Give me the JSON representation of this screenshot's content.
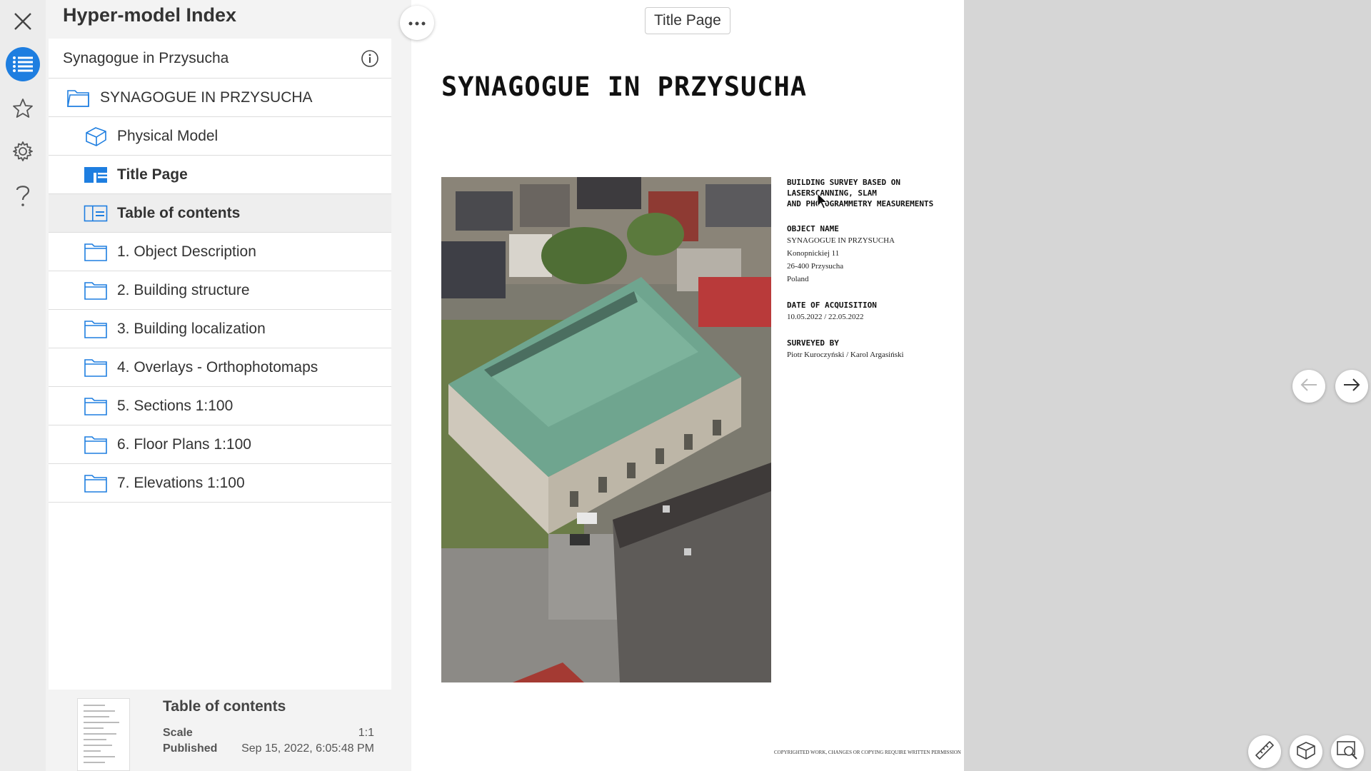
{
  "colors": {
    "accent": "#1e7ee0",
    "icon_blue": "#1e7ee0"
  },
  "rail": {
    "icons": [
      "close-icon",
      "index-list-icon",
      "star-icon",
      "gear-icon",
      "help-icon"
    ]
  },
  "panel": {
    "title": "Hyper-model Index",
    "search_value": "Synagogue in Przysucha",
    "items": [
      {
        "label": "SYNAGOGUE IN PRZYSUCHA",
        "icon": "folder-open-icon"
      },
      {
        "label": "Physical Model",
        "icon": "cube-icon"
      },
      {
        "label": "Title Page",
        "icon": "title-page-icon"
      },
      {
        "label": "Table of contents",
        "icon": "contents-page-icon"
      },
      {
        "label": "1. Object Description",
        "icon": "folder-icon"
      },
      {
        "label": "2. Building structure",
        "icon": "folder-icon"
      },
      {
        "label": "3. Building localization",
        "icon": "folder-icon"
      },
      {
        "label": "4. Overlays - Orthophotomaps",
        "icon": "folder-icon"
      },
      {
        "label": "5. Sections 1:100",
        "icon": "folder-icon"
      },
      {
        "label": "6. Floor Plans 1:100",
        "icon": "folder-icon"
      },
      {
        "label": "7. Elevations 1:100",
        "icon": "folder-icon"
      }
    ]
  },
  "details": {
    "title": "Table of contents",
    "scale_label": "Scale",
    "scale_value": "1:1",
    "published_label": "Published",
    "published_value": "Sep 15, 2022, 6:05:48 PM"
  },
  "viewer": {
    "page_label": "Title Page",
    "doc_title": "SYNAGOGUE IN PRZYSUCHA",
    "survey_lines": [
      "BUILDING SURVEY BASED ON",
      "LASERSCANNING, SLAM",
      "AND PHOTOGRAMMETRY MEASUREMENTS"
    ],
    "object_heading": "OBJECT NAME",
    "object_lines": [
      "SYNAGOGUE IN PRZYSUCHA",
      "Konopnickiej 11",
      "26-400 Przysucha",
      "Poland"
    ],
    "acq_heading": "DATE OF ACQUISITION",
    "acq_value": "10.05.2022 / 22.05.2022",
    "surveyed_heading": "SURVEYED BY",
    "surveyed_value": "Piotr Kuroczyński / Karol Argasiński",
    "footer_note": "COPYRIGHTED WORK, CHANGES OR COPYING REQUIRE WRITTEN PERMISSION"
  },
  "controls": {
    "nav": [
      "arrow-left-icon",
      "arrow-right-icon"
    ],
    "tools": [
      "ruler-icon",
      "cube-view-icon",
      "zoom-page-icon"
    ]
  }
}
